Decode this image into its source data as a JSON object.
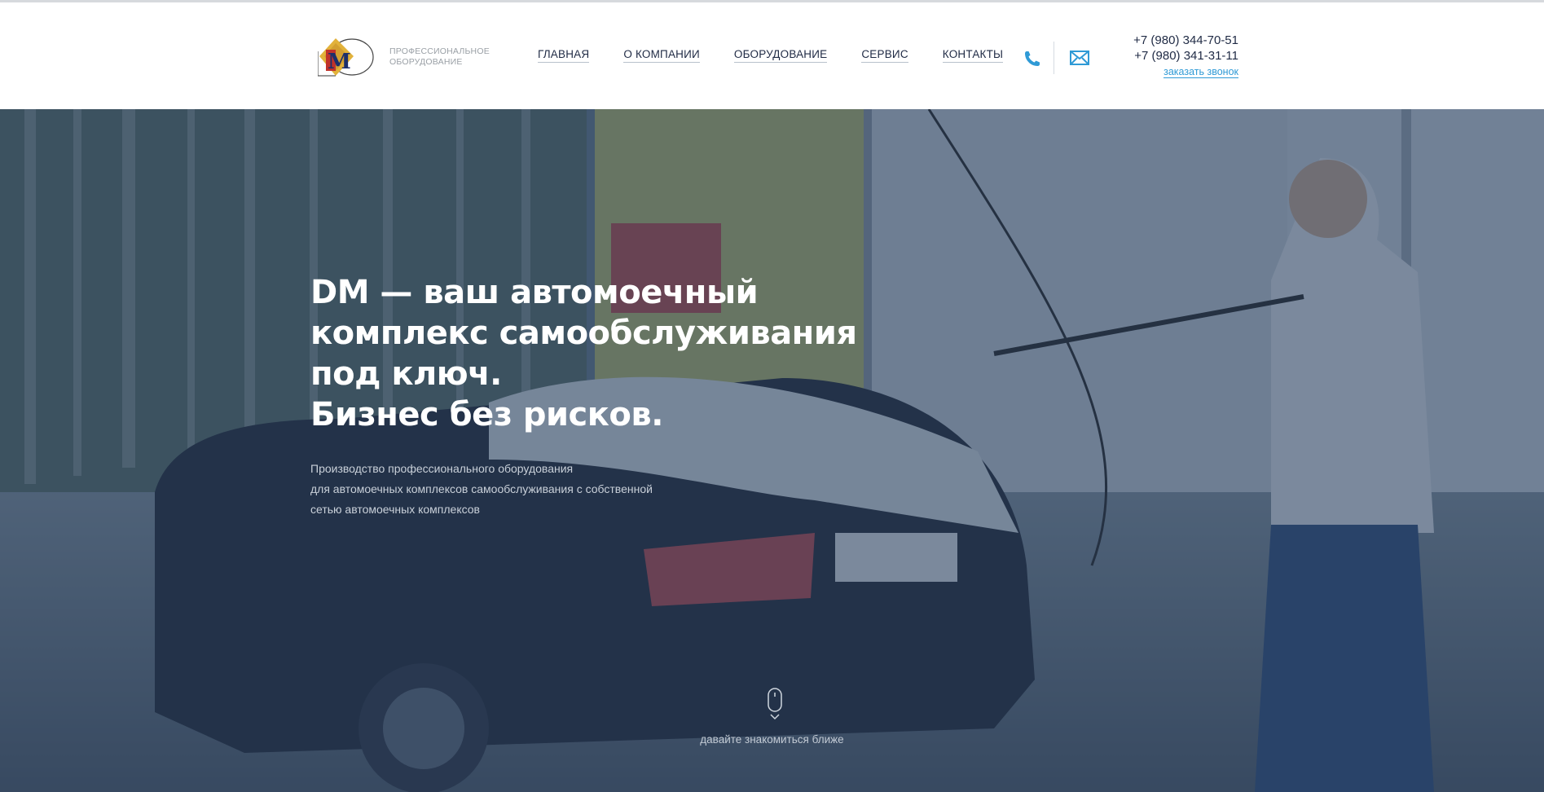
{
  "header": {
    "logo_text": "DM",
    "tagline": [
      "ПРОФЕССИОНАЛЬНОЕ",
      "ОБОРУДОВАНИЕ"
    ],
    "nav": [
      {
        "label": "ГЛАВНАЯ"
      },
      {
        "label": "О КОМПАНИИ"
      },
      {
        "label": "ОБОРУДОВАНИЕ"
      },
      {
        "label": "СЕРВИС"
      },
      {
        "label": "КОНТАКТЫ"
      }
    ],
    "icons": [
      "phone-icon",
      "mail-icon"
    ],
    "phones": [
      "+7 (980) 344-70-51",
      "+7 (980) 341-31-11"
    ],
    "callback_label": "заказать звонок",
    "colors": {
      "nav_text": "#1f2a44",
      "accent": "#2f9ad6"
    }
  },
  "hero": {
    "title_lines": [
      "DM — ваш автомоечный",
      "комплекс самообслуживания",
      "под ключ.",
      "Бизнес без рисков."
    ],
    "subtitle_lines": [
      "Производство профессионального оборудования",
      "для автомоечных комплексов самообслуживания с собственной",
      "сетью автомоечных комплексов"
    ],
    "scroll_label": "давайте знакомиться ближе",
    "scroll_icon": "mouse-icon",
    "overlay_color": "#283e5c"
  }
}
